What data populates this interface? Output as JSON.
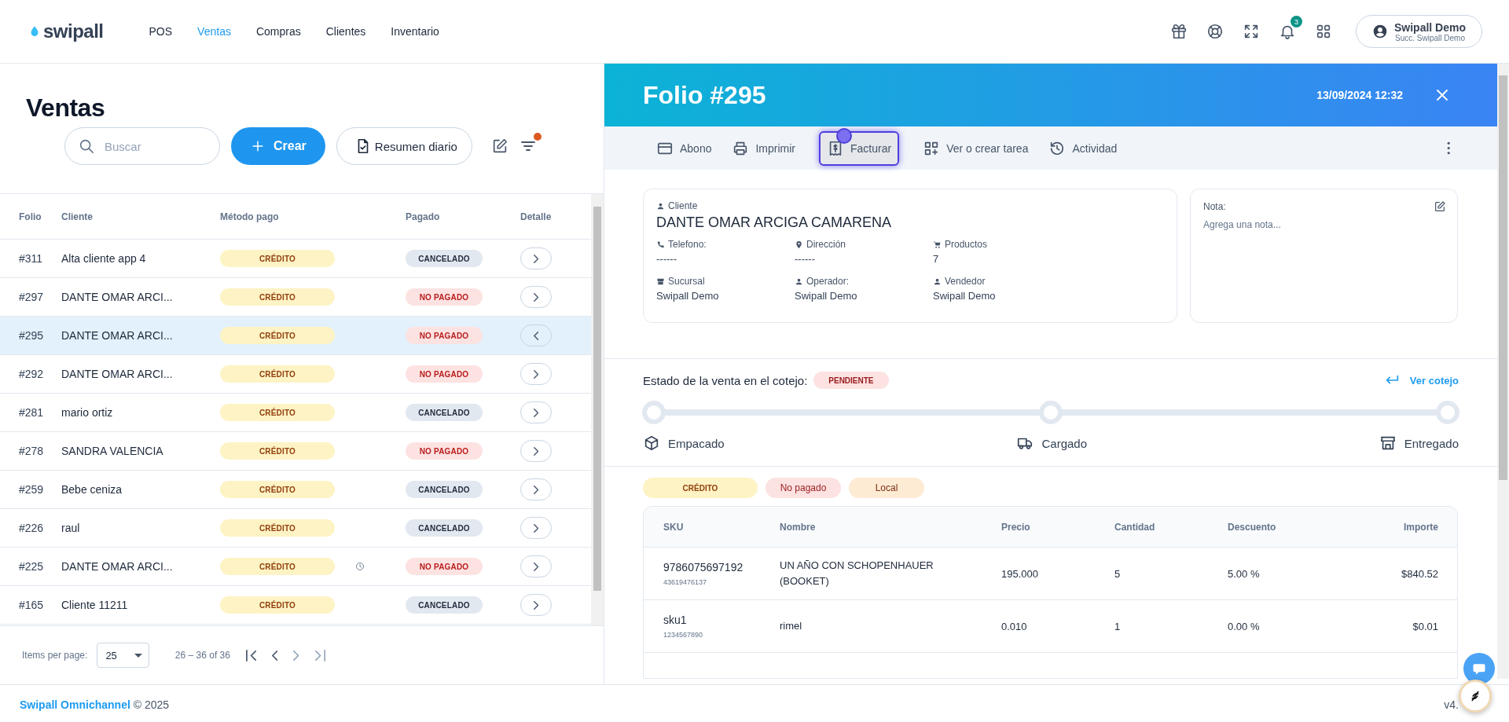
{
  "topbar": {
    "logo": "swipall",
    "nav": [
      {
        "label": "POS",
        "selected": false
      },
      {
        "label": "Ventas",
        "selected": true
      },
      {
        "label": "Compras",
        "selected": false
      },
      {
        "label": "Clientes",
        "selected": false
      },
      {
        "label": "Inventario",
        "selected": false
      }
    ],
    "notifications": "3",
    "user": {
      "name": "Swipall Demo",
      "branch": "Succ. Swipall Demo"
    }
  },
  "sales": {
    "title": "Ventas",
    "search": {
      "placeholder": "Buscar"
    },
    "create_button": "Crear",
    "summary_button": "Resumen diario",
    "filter_active": true,
    "columns": [
      "Folio",
      "Cliente",
      "Método pago",
      "Pagado",
      "Detalle"
    ],
    "rows": [
      {
        "folio": "#311",
        "client": "Alta cliente app 4",
        "method": "CRÉDITO",
        "scheduled": false,
        "paid": "CANCELADO",
        "color": "#e2e8f0",
        "selected": false
      },
      {
        "folio": "#297",
        "client": "DANTE OMAR ARCI...",
        "method": "CRÉDITO",
        "scheduled": false,
        "paid": "NO PAGADO",
        "color": "#fde2e2",
        "selected": false
      },
      {
        "folio": "#295",
        "client": "DANTE OMAR ARCI...",
        "method": "CRÉDITO",
        "scheduled": false,
        "paid": "NO PAGADO",
        "color": "#fde2e2",
        "selected": true
      },
      {
        "folio": "#292",
        "client": "DANTE OMAR ARCI...",
        "method": "CRÉDITO",
        "scheduled": false,
        "paid": "NO PAGADO",
        "color": "#fde2e2",
        "selected": false
      },
      {
        "folio": "#281",
        "client": "mario ortiz",
        "method": "CRÉDITO",
        "scheduled": false,
        "paid": "CANCELADO",
        "color": "#e2e8f0",
        "selected": false
      },
      {
        "folio": "#278",
        "client": "SANDRA VALENCIA",
        "method": "CRÉDITO",
        "scheduled": false,
        "paid": "NO PAGADO",
        "color": "#fde2e2",
        "selected": false
      },
      {
        "folio": "#259",
        "client": "Bebe ceniza",
        "method": "CRÉDITO",
        "scheduled": false,
        "paid": "CANCELADO",
        "color": "#e2e8f0",
        "selected": false
      },
      {
        "folio": "#226",
        "client": "raul",
        "method": "CRÉDITO",
        "scheduled": false,
        "paid": "CANCELADO",
        "color": "#e2e8f0",
        "selected": false
      },
      {
        "folio": "#225",
        "client": "DANTE OMAR ARCI...",
        "method": "CRÉDITO",
        "scheduled": true,
        "paid": "NO PAGADO",
        "color": "#fde2e2",
        "selected": false
      },
      {
        "folio": "#165",
        "client": "Cliente 11211",
        "method": "CRÉDITO",
        "scheduled": false,
        "paid": "CANCELADO",
        "color": "#e2e8f0",
        "selected": false
      }
    ],
    "pagination": {
      "label": "Items per page:",
      "page_size": "25",
      "range": "26 – 36 of 36"
    }
  },
  "detail": {
    "title": "Folio #295",
    "date": "13/09/2024 12:32",
    "actions": [
      {
        "label": "Abono",
        "focused": false
      },
      {
        "label": "Imprimir",
        "focused": false
      },
      {
        "label": "Facturar",
        "focused": true
      },
      {
        "label": "Ver o crear tarea",
        "focused": false
      },
      {
        "label": "Actividad",
        "focused": false
      }
    ],
    "client": {
      "label": "Cliente",
      "name": "DANTE OMAR ARCIGA CAMARENA",
      "fields": [
        {
          "label": "Telefono:",
          "value": "------"
        },
        {
          "label": "Dirección",
          "value": "------"
        },
        {
          "label": "Productos",
          "value": "7"
        },
        {
          "label": "Sucursal",
          "value": "Swipall Demo"
        },
        {
          "label": "Operador:",
          "value": "Swipall Demo"
        },
        {
          "label": "Vendedor",
          "value": "Swipall Demo"
        }
      ]
    },
    "note": {
      "label": "Nota:",
      "placeholder": "Agrega una nota..."
    },
    "status": {
      "label": "Estado de la venta en el cotejo:",
      "value": "PENDIENTE",
      "link": "Ver cotejo",
      "steps": [
        {
          "label": "Empacado",
          "done": false
        },
        {
          "label": "Cargado",
          "done": false
        },
        {
          "label": "Entregado",
          "done": false
        }
      ]
    },
    "chips": [
      {
        "label": "CRÉDITO",
        "kind": "credit"
      },
      {
        "label": "No pagado",
        "kind": "unpaid"
      },
      {
        "label": "Local",
        "kind": "local"
      }
    ],
    "products": {
      "columns": [
        "SKU",
        "Nombre",
        "Precio",
        "Cantidad",
        "Descuento",
        "Importe"
      ],
      "rows": [
        {
          "sku": "9786075697192",
          "code": "43619476137",
          "name": "UN AÑO CON SCHOPENHAUER (BOOKET)",
          "price": "195.000",
          "qty": "5",
          "discount": "5.00 %",
          "amount": "$840.52"
        },
        {
          "sku": "sku1",
          "code": "1234567890",
          "name": "rimel",
          "price": "0.010",
          "qty": "1",
          "discount": "0.00 %",
          "amount": "$0.01"
        }
      ]
    }
  },
  "footer": {
    "brand": "Swipall Omnichannel",
    "copyright": "© 2025",
    "version": "v4."
  }
}
